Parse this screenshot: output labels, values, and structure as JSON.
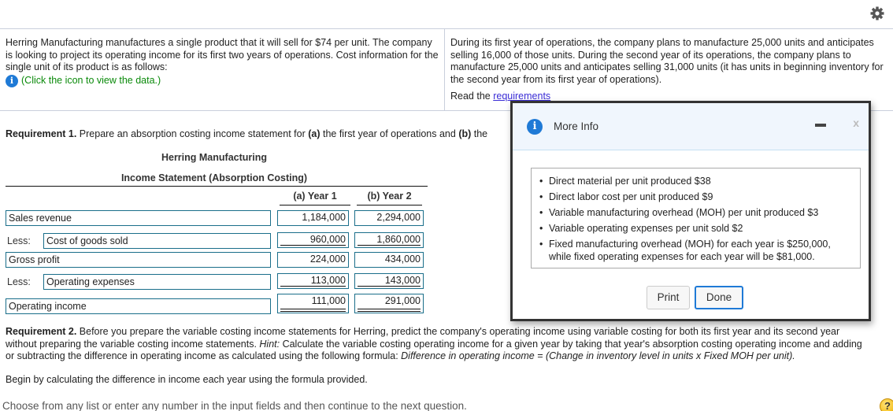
{
  "toolbar": {
    "settings_icon": "gear-icon"
  },
  "problem": {
    "left_text": "Herring Manufacturing manufactures a single product that it will sell for $74 per unit. The company is looking to project its operating income for its first two years of operations. Cost information for the single unit of its product is as follows:",
    "data_link": "(Click the icon to view the data.)",
    "right_text": "During its first year of operations, the company plans to manufacture 25,000 units and anticipates selling 16,000 of those units. During the second year of its operations, the company plans to manufacture 25,000 units and anticipates selling 31,000 units (it has units in beginning inventory for the second year from its first year of operations).",
    "read_prefix": "Read the ",
    "read_link": "requirements"
  },
  "requirement1": {
    "label": "Requirement 1.",
    "text_1": " Prepare an absorption costing income statement for ",
    "a": "(a)",
    "text_2": " the first year of operations and ",
    "b": "(b)",
    "text_3": " the"
  },
  "statement": {
    "company": "Herring Manufacturing",
    "title": "Income Statement (Absorption Costing)",
    "col_a": "(a) Year 1",
    "col_b": "(b) Year 2",
    "less_label": "Less:",
    "rows": [
      {
        "label": "Sales revenue",
        "year1": "1,184,000",
        "year2": "2,294,000"
      },
      {
        "label": "Cost of goods sold",
        "year1": "960,000",
        "year2": "1,860,000"
      },
      {
        "label": "Gross profit",
        "year1": "224,000",
        "year2": "434,000"
      },
      {
        "label": "Operating expenses",
        "year1": "113,000",
        "year2": "143,000"
      },
      {
        "label": "Operating income",
        "year1": "111,000",
        "year2": "291,000"
      }
    ]
  },
  "requirement2": {
    "label": "Requirement 2.",
    "text_1": " Before you prepare the variable costing income statements for Herring, predict the company's operating income using variable costing for both its first year and its second year without preparing the variable costing income statements. ",
    "hint_label": "Hint:",
    "text_2": " Calculate the variable costing operating income for a given year by taking that year's absorption costing operating income and adding or subtracting the difference in operating income as calculated using the following formula: ",
    "formula": "Difference in operating income = (Change in inventory level in units x Fixed MOH per unit).",
    "begin": "Begin by calculating the difference in income each year using the formula provided."
  },
  "footer": {
    "hint": "Choose from any list or enter any number in the input fields and then continue to the next question.",
    "help": "?"
  },
  "modal": {
    "title": "More Info",
    "items": [
      "Direct material per unit produced $38",
      "Direct labor cost per unit produced $9",
      "Variable manufacturing overhead (MOH) per unit produced $3",
      "Variable operating expenses per unit sold $2",
      "Fixed manufacturing overhead (MOH) for each year is $250,000, while fixed operating expenses for each year will be $81,000."
    ],
    "print_label": "Print",
    "done_label": "Done",
    "close_label": "x"
  },
  "colors": {
    "accent_blue": "#1f7ad6",
    "link_green": "#0a8a0a",
    "input_border": "#1a6e8a",
    "modal_header_bg": "#f0f6fd"
  }
}
